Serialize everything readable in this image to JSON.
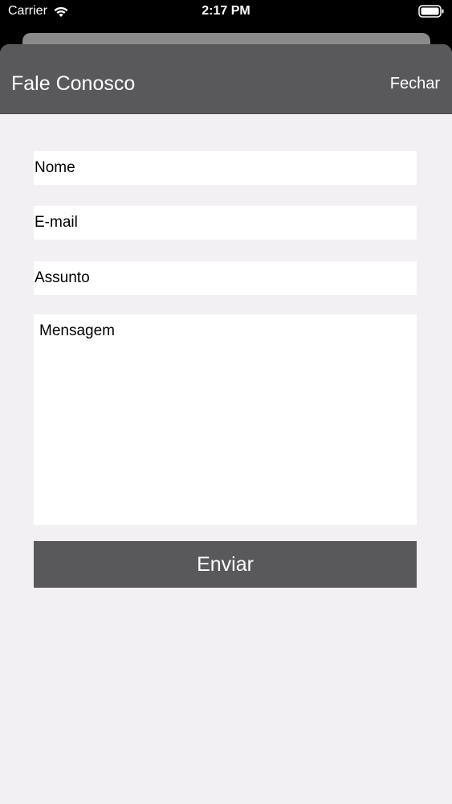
{
  "status_bar": {
    "carrier": "Carrier",
    "time": "2:17 PM",
    "wifi_icon": "wifi-icon",
    "battery_icon": "battery-icon"
  },
  "nav": {
    "title": "Fale Conosco",
    "close_label": "Fechar"
  },
  "form": {
    "name_placeholder": "Nome",
    "email_placeholder": "E-mail",
    "subject_placeholder": "Assunto",
    "message_placeholder": "Mensagem",
    "submit_label": "Enviar"
  },
  "colors": {
    "nav_background": "#59585b",
    "page_background": "#f2f0f3",
    "field_background": "#ffffff",
    "button_background": "#59585b"
  }
}
